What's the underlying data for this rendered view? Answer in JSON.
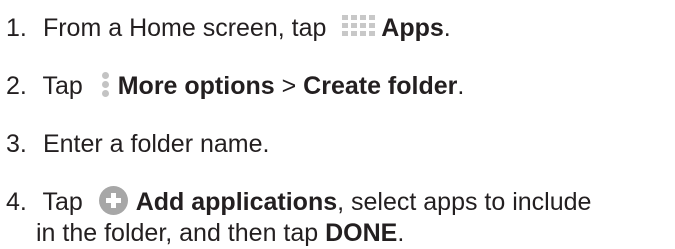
{
  "steps": [
    {
      "number": "1.",
      "text_before": "From a Home screen, tap ",
      "icon": "apps-grid-icon",
      "bold": "Apps",
      "text_after": "."
    },
    {
      "number": "2.",
      "text_before": "Tap ",
      "icon": "more-options-icon",
      "bold": "More options",
      "text_middle": " > ",
      "bold2": "Create folder",
      "text_after": "."
    },
    {
      "number": "3.",
      "text": "Enter a folder name."
    },
    {
      "number": "4.",
      "text_before": "Tap ",
      "icon": "add-circle-icon",
      "bold": "Add applications",
      "text_after": ", select apps to include",
      "line2_text": "in the folder, and then tap ",
      "line2_bold": "DONE",
      "line2_after": "."
    }
  ],
  "colors": {
    "text": "#231f20",
    "icon_grey": "#c8c8c8",
    "add_icon_grey": "#a7a7a7"
  }
}
